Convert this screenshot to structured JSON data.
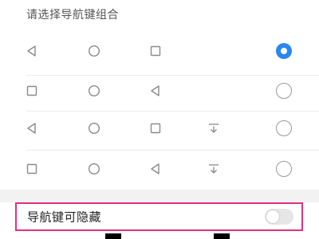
{
  "header": {
    "title": "请选择导航键组合"
  },
  "options": [
    {
      "icons": [
        "back-triangle-icon",
        "home-circle-icon",
        "recents-square-icon"
      ],
      "selected": true
    },
    {
      "icons": [
        "recents-square-icon",
        "home-circle-icon",
        "back-triangle-icon"
      ],
      "selected": false
    },
    {
      "icons": [
        "back-triangle-icon",
        "home-circle-icon",
        "recents-square-icon",
        "notification-pull-down-icon"
      ],
      "selected": false
    },
    {
      "icons": [
        "recents-square-icon",
        "home-circle-icon",
        "back-triangle-icon",
        "notification-pull-down-icon"
      ],
      "selected": false
    }
  ],
  "hide_setting": {
    "label": "导航键可隐藏",
    "enabled": false
  },
  "colors": {
    "accent": "#2b86f5",
    "highlight_border": "#e2307d",
    "icon": "#8a8a8a"
  }
}
